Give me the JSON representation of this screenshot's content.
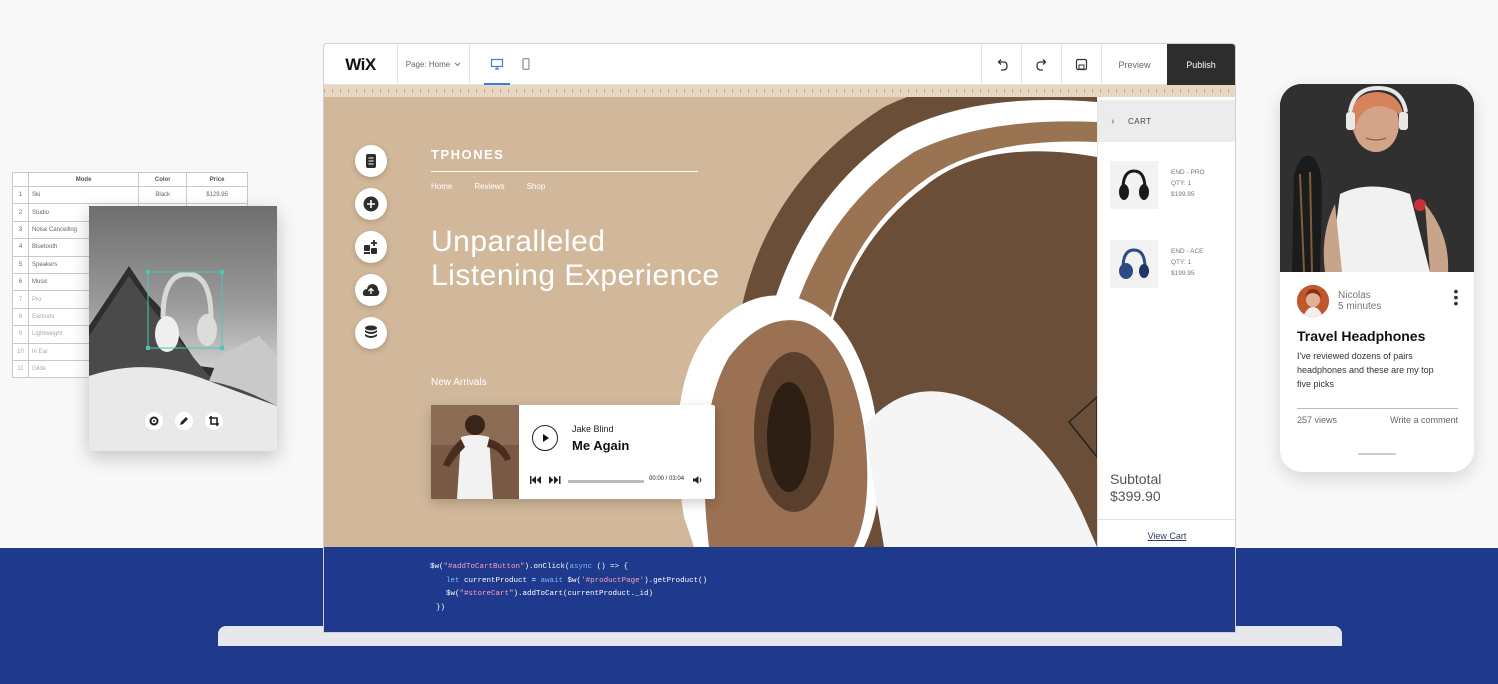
{
  "spreadsheet": {
    "headers": [
      "Mode",
      "Color",
      "Price"
    ],
    "rows": [
      {
        "num": "1",
        "mode": "Ski",
        "color": "Black",
        "price": "$129.95"
      },
      {
        "num": "2",
        "mode": "Studio",
        "color": "",
        "price": ""
      },
      {
        "num": "3",
        "mode": "Noise Cancelling",
        "color": "",
        "price": ""
      },
      {
        "num": "4",
        "mode": "Bluetooth",
        "color": "",
        "price": ""
      },
      {
        "num": "5",
        "mode": "Speakers",
        "color": "",
        "price": ""
      },
      {
        "num": "6",
        "mode": "Music",
        "color": "",
        "price": ""
      },
      {
        "num": "7",
        "mode": "Pro",
        "color": "",
        "price": ""
      },
      {
        "num": "8",
        "mode": "Earbuds",
        "color": "",
        "price": ""
      },
      {
        "num": "9",
        "mode": "Lightweight",
        "color": "",
        "price": ""
      },
      {
        "num": "10",
        "mode": "In Ear",
        "color": "",
        "price": ""
      },
      {
        "num": "11",
        "mode": "Glide",
        "color": "",
        "price": ""
      }
    ]
  },
  "image_editor": {
    "tools": [
      "gear-icon",
      "pencil-icon",
      "crop-icon"
    ]
  },
  "editor": {
    "logo": "WiX",
    "page_selector": "Page: Home",
    "preview_label": "Preview",
    "publish_label": "Publish"
  },
  "site": {
    "brand": "TPHONES",
    "nav": [
      "Home",
      "Reviews",
      "Shop"
    ],
    "headline_line1": "Unparalleled",
    "headline_line2": "Listening Experience",
    "new_arrivals": "New Arrivals",
    "player": {
      "artist": "Jake Blind",
      "song": "Me Again",
      "time": "00:00 / 03:04",
      "progress": 0
    }
  },
  "cart": {
    "title": "CART",
    "items": [
      {
        "name": "END - PRO",
        "qty": "QTY: 1",
        "price": "$199.95",
        "color": "#1a1a1a"
      },
      {
        "name": "END - ACE",
        "qty": "QTY: 1",
        "price": "$199.95",
        "color": "#2c4a86"
      }
    ],
    "subtotal_label": "Subtotal",
    "subtotal_value": "$399.90",
    "view_cart": "View Cart"
  },
  "code": {
    "line1_a": "$w(",
    "line1_b": "\"#addToCartButton\"",
    "line1_c": ").onClick(",
    "line1_d": "async",
    "line1_e": " () => {",
    "line2_a": "let",
    "line2_b": " currentProduct = ",
    "line2_c": "await",
    "line2_d": " $w(",
    "line2_e": "'#productPage'",
    "line2_f": ").getProduct()",
    "line3_a": "$w(",
    "line3_b": "\"#storeCart\"",
    "line3_c": ").addToCart(currentProduct._id)",
    "line4": "})"
  },
  "phone": {
    "author_name": "Nicolas",
    "author_time": "5 minutes",
    "post_title": "Travel Headphones",
    "post_body": "I've reviewed dozens of pairs headphones and these are my top five picks",
    "views": "257 views",
    "comment": "Write a comment"
  },
  "colors": {
    "hero_bg": "#d2b89a",
    "code_bg": "#1f3a8c",
    "publish_bg": "#2d2d2d"
  }
}
